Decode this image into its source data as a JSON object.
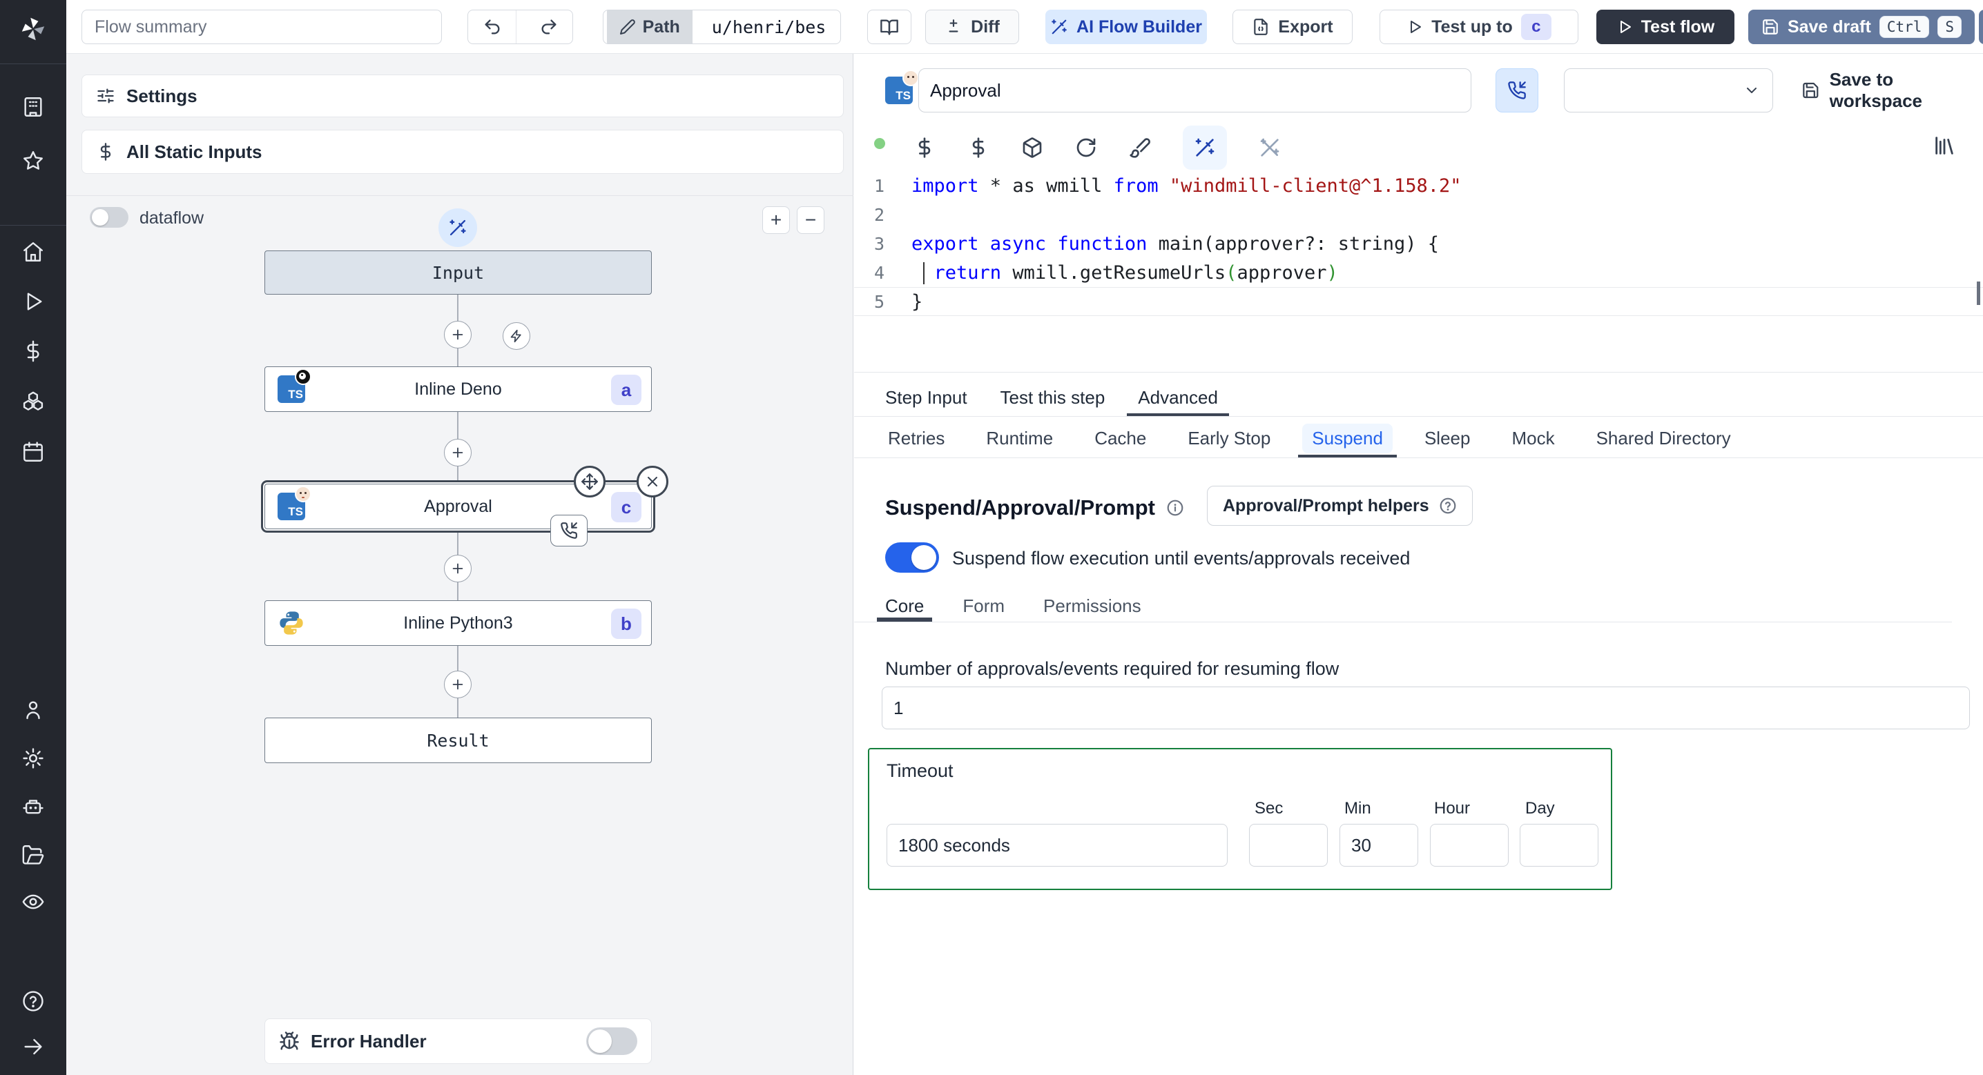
{
  "topbar": {
    "flow_summary_value": "Flow summary",
    "path_label": "Path",
    "path_value": "u/henri/bes",
    "diff_label": "Diff",
    "ai_builder_label": "AI Flow Builder",
    "export_label": "Export",
    "test_up_to_label": "Test up to",
    "test_up_to_badge": "c",
    "test_flow_label": "Test flow",
    "save_draft_label": "Save draft",
    "kbd_ctrl": "Ctrl",
    "kbd_s": "S"
  },
  "sidebar": {
    "icons": [
      "windmill-logo",
      "workspace-building",
      "favorites-star",
      "home",
      "runs-play",
      "variables-dollar",
      "resources-boxes",
      "schedules-calendar",
      "users-person",
      "settings-gear",
      "workers-robot",
      "folders-folder",
      "audit-eye",
      "help-question",
      "expand-arrow-right"
    ]
  },
  "flow_panel": {
    "settings_label": "Settings",
    "static_inputs_label": "All Static Inputs",
    "dataflow_label": "dataflow",
    "zoom_plus": "+",
    "zoom_minus": "−",
    "error_handler_label": "Error Handler"
  },
  "graph": {
    "input_label": "Input",
    "deno": {
      "label": "Inline Deno",
      "badge": "a"
    },
    "approval": {
      "label": "Approval",
      "badge": "c"
    },
    "python": {
      "label": "Inline Python3",
      "badge": "b"
    },
    "result_label": "Result"
  },
  "step_panel": {
    "title_value": "Approval",
    "save_to_workspace_label": "Save to workspace",
    "code": {
      "numbers": [
        "1",
        "2",
        "3",
        "4",
        "5"
      ],
      "lines": [
        [
          [
            "k",
            "import"
          ],
          [
            "p",
            " * as wmill "
          ],
          [
            "k",
            "from"
          ],
          [
            "p",
            " "
          ],
          [
            "s",
            "\"windmill-client@^1.158.2\""
          ]
        ],
        [],
        [
          [
            "k",
            "export async function"
          ],
          [
            "p",
            " main(approver?: string) {"
          ]
        ],
        [
          [
            "p",
            "  "
          ],
          [
            "k",
            "return"
          ],
          [
            "p",
            " wmill.getResumeUrls"
          ],
          [
            "g",
            "("
          ],
          [
            "p",
            "approver"
          ],
          [
            "g",
            ")"
          ]
        ],
        [
          [
            "p",
            "}"
          ]
        ]
      ]
    },
    "tabs": [
      "Step Input",
      "Test this step",
      "Advanced"
    ],
    "subtabs": [
      "Retries",
      "Runtime",
      "Cache",
      "Early Stop",
      "Suspend",
      "Sleep",
      "Mock",
      "Shared Directory"
    ],
    "suspend": {
      "heading": "Suspend/Approval/Prompt",
      "helpers_label": "Approval/Prompt helpers",
      "toggle_label": "Suspend flow execution until events/approvals received",
      "core_tabs": [
        "Core",
        "Form",
        "Permissions"
      ],
      "approvals_label": "Number of approvals/events required for resuming flow",
      "approvals_value": "1",
      "timeout": {
        "label": "Timeout",
        "seconds_value": "1800 seconds",
        "units": [
          "Sec",
          "Min",
          "Hour",
          "Day"
        ],
        "sec_value": "",
        "min_value": "30",
        "hour_value": "",
        "day_value": ""
      }
    }
  },
  "colors": {
    "accent_blue": "#2563eb",
    "ai_button_bg": "#dbeafe",
    "ai_button_text": "#1e40af",
    "save_draft_bg": "#64799e",
    "test_flow_bg": "#2f3542",
    "badge_bg": "#e0e4fc",
    "badge_text": "#4040c8",
    "timeout_border": "#15803d",
    "keyword": "#0000ff",
    "string": "#a31515",
    "status_dot": "#84d184",
    "sidebar_bg": "#24272e"
  }
}
